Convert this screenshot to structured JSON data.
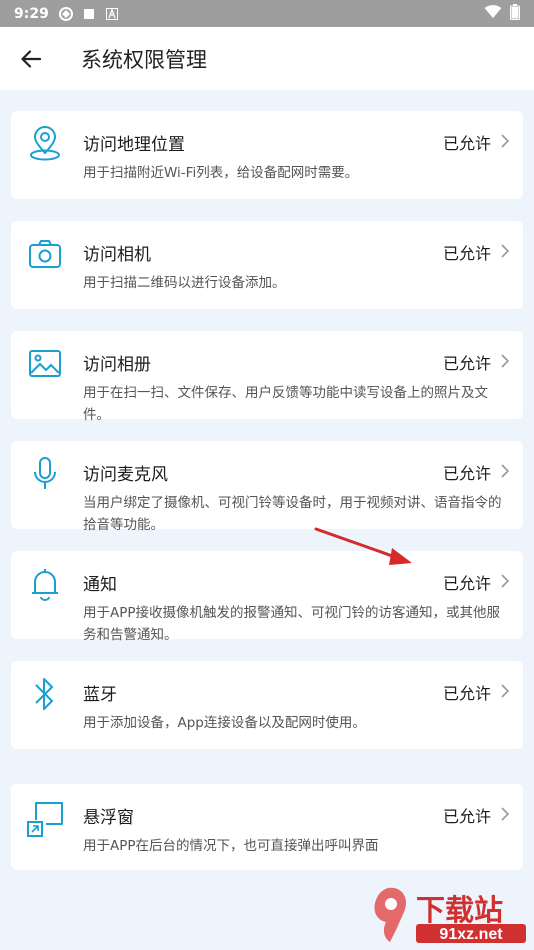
{
  "status_bar": {
    "time": "9:29"
  },
  "app_bar": {
    "title": "系统权限管理"
  },
  "permissions": [
    {
      "name": "访问地理位置",
      "status": "已允许",
      "desc": "用于扫描附近Wi-Fi列表，给设备配网时需要。",
      "icon": "location-pin-icon"
    },
    {
      "name": "访问相机",
      "status": "已允许",
      "desc": "用于扫描二维码以进行设备添加。",
      "icon": "camera-icon"
    },
    {
      "name": "访问相册",
      "status": "已允许",
      "desc": "用于在扫一扫、文件保存、用户反馈等功能中读写设备上的照片及文件。",
      "icon": "image-icon"
    },
    {
      "name": "访问麦克风",
      "status": "已允许",
      "desc": "当用户绑定了摄像机、可视门铃等设备时，用于视频对讲、语音指令的拾音等功能。",
      "icon": "microphone-icon"
    },
    {
      "name": "通知",
      "status": "已允许",
      "desc": "用于APP接收摄像机触发的报警通知、可视门铃的访客通知，或其他服务和告警通知。",
      "icon": "bell-icon"
    },
    {
      "name": "蓝牙",
      "status": "已允许",
      "desc": "用于添加设备，App连接设备以及配网时使用。",
      "icon": "bluetooth-icon"
    },
    {
      "name": "悬浮窗",
      "status": "已允许",
      "desc": "用于APP在后台的情况下，也可直接弹出呼叫界面",
      "icon": "floating-window-icon"
    }
  ],
  "watermark": {
    "text": "下载站",
    "domain": "91xz.net"
  },
  "colors": {
    "accent": "#1aa0d0",
    "arrow": "#d42a2a",
    "background": "#eef4fb"
  }
}
